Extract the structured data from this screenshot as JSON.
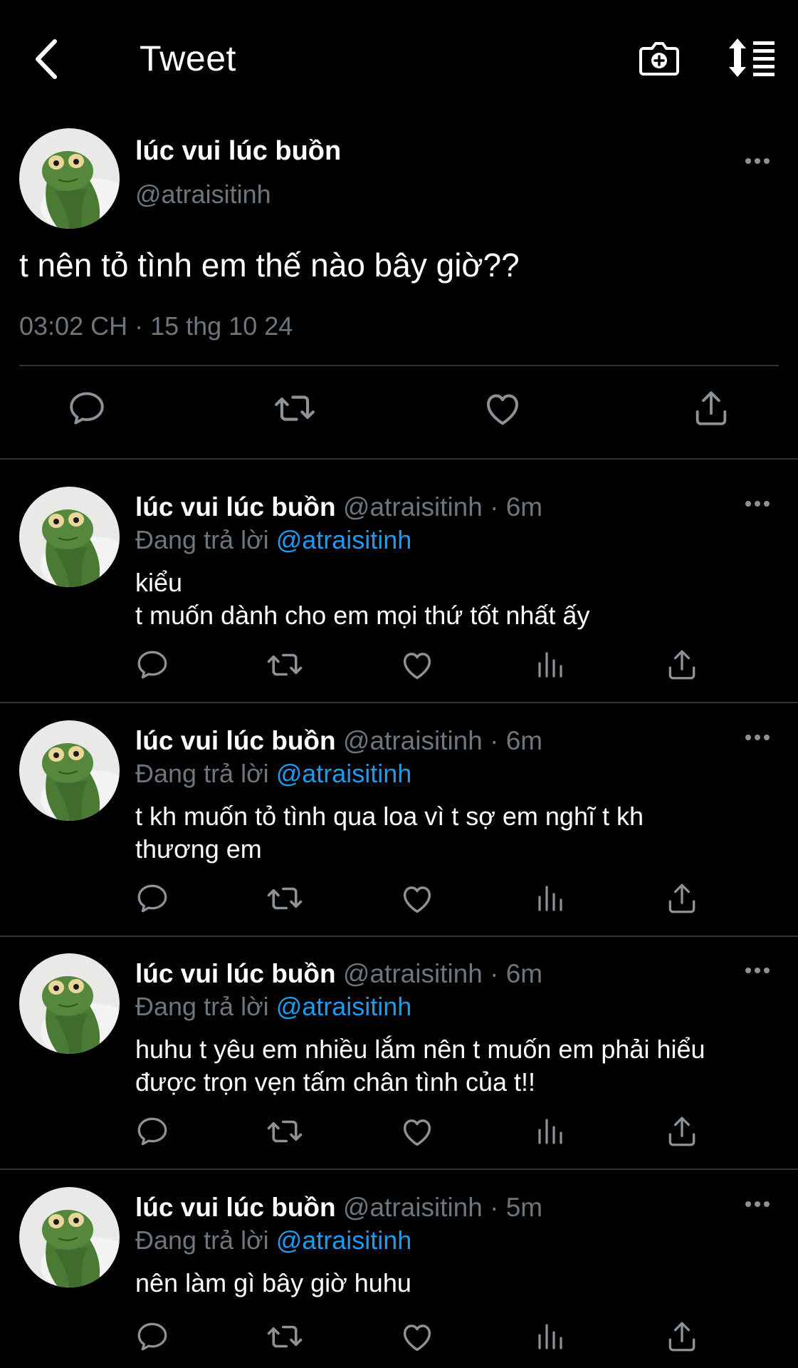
{
  "header": {
    "title": "Tweet",
    "back_icon": "chevron-left-icon",
    "camera_icon": "camera-plus-icon",
    "sort_icon": "sort-icon"
  },
  "main_tweet": {
    "name": "lúc vui lúc buồn",
    "handle": "@atraisitinh",
    "text": "t nên tỏ tình em thế nào bây giờ??",
    "timestamp": "03:02 CH · 15 thg 10 24"
  },
  "replies": [
    {
      "name": "lúc vui lúc buồn",
      "meta": "@atraisitinh · 6m",
      "replying_prefix": "Đang trả lời ",
      "mention": "@atraisitinh",
      "line1": "kiểu",
      "line2": "t muốn dành cho em mọi thứ tốt nhất ấy"
    },
    {
      "name": "lúc vui lúc buồn",
      "meta": "@atraisitinh · 6m",
      "replying_prefix": "Đang trả lời ",
      "mention": "@atraisitinh",
      "line1": "t kh muốn tỏ tình qua loa vì t sợ em nghĩ t kh",
      "line2": "thương em"
    },
    {
      "name": "lúc vui lúc buồn",
      "meta": "@atraisitinh · 6m",
      "replying_prefix": "Đang trả lời ",
      "mention": "@atraisitinh",
      "line1": "huhu t yêu em nhiều lắm nên t muốn em phải hiểu",
      "line2": "được trọn vẹn tấm chân tình của t!!"
    },
    {
      "name": "lúc vui lúc buồn",
      "meta": "@atraisitinh · 5m",
      "replying_prefix": "Đang trả lời ",
      "mention": "@atraisitinh",
      "line1": "nên làm gì bây giờ huhu",
      "line2": ""
    }
  ],
  "colors": {
    "background": "#000000",
    "text": "#ffffff",
    "secondary": "#6e767d",
    "link": "#1d9bf0",
    "divider": "#2f3336"
  }
}
